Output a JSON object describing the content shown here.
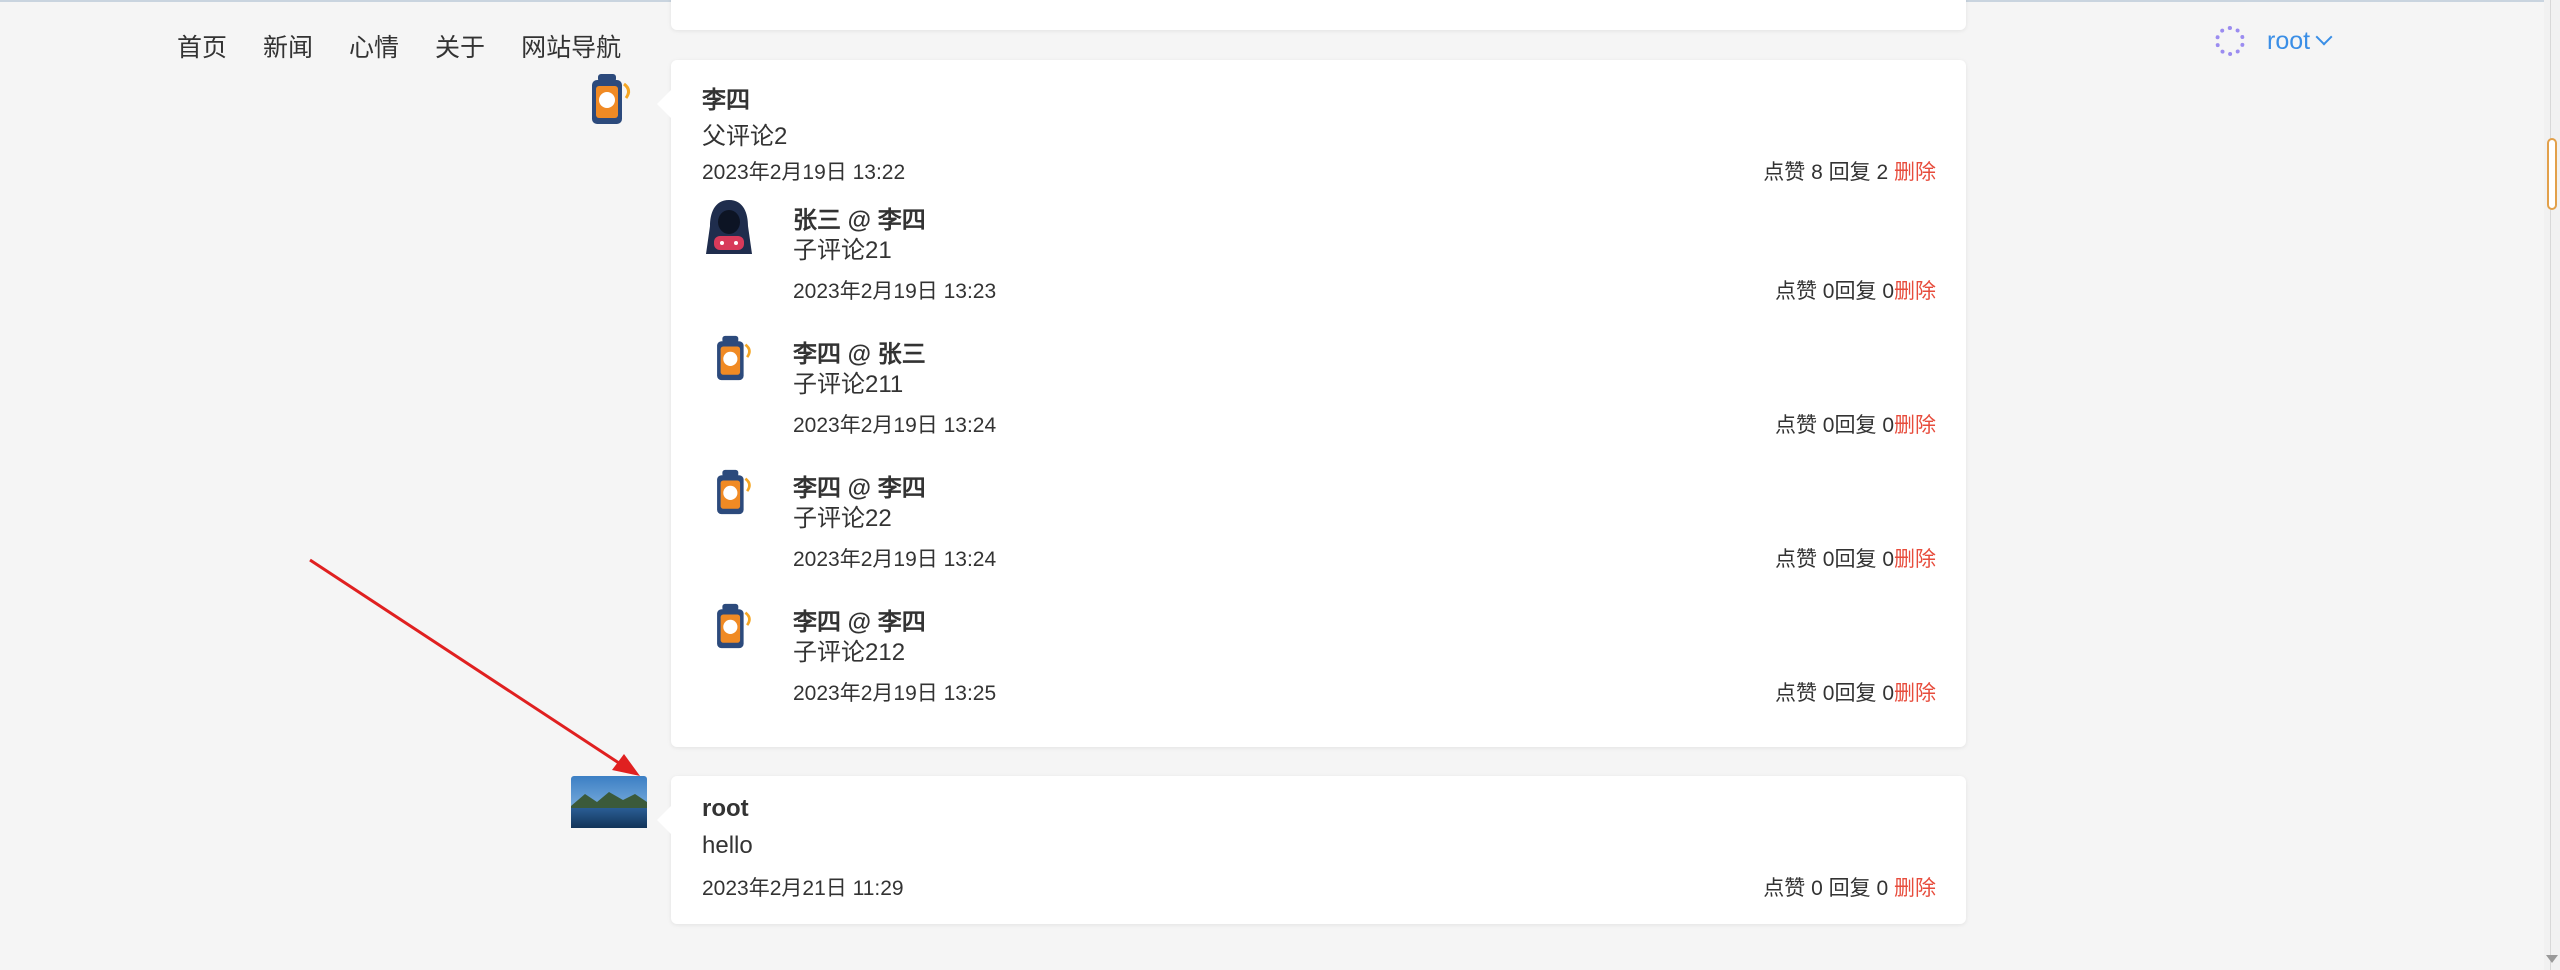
{
  "nav": {
    "items": [
      "首页",
      "新闻",
      "心情",
      "关于",
      "网站导航"
    ]
  },
  "user": {
    "name": "root"
  },
  "comments": [
    {
      "author": "李四",
      "text": "父评论2",
      "time": "2023年2月19日 13:22",
      "stats": "点赞 8 回复 2 ",
      "delete_label": "删除",
      "replies": [
        {
          "header": "张三 @ 李四",
          "text": "子评论21",
          "time": "2023年2月19日 13:23",
          "stats": "点赞 0回复 0",
          "delete_label": "删除"
        },
        {
          "header": "李四 @ 张三",
          "text": "子评论211",
          "time": "2023年2月19日 13:24",
          "stats": "点赞 0回复 0",
          "delete_label": "删除"
        },
        {
          "header": "李四 @ 李四",
          "text": "子评论22",
          "time": "2023年2月19日 13:24",
          "stats": "点赞 0回复 0",
          "delete_label": "删除"
        },
        {
          "header": "李四 @ 李四",
          "text": "子评论212",
          "time": "2023年2月19日 13:25",
          "stats": "点赞 0回复 0",
          "delete_label": "删除"
        }
      ]
    },
    {
      "author": "root",
      "text": "hello",
      "time": "2023年2月21日 11:29",
      "stats": "点赞 0 回复 0 ",
      "delete_label": "删除"
    }
  ],
  "colors": {
    "accent": "#3a8ee6",
    "delete": "#e74c3c",
    "arrow": "#e02020"
  }
}
